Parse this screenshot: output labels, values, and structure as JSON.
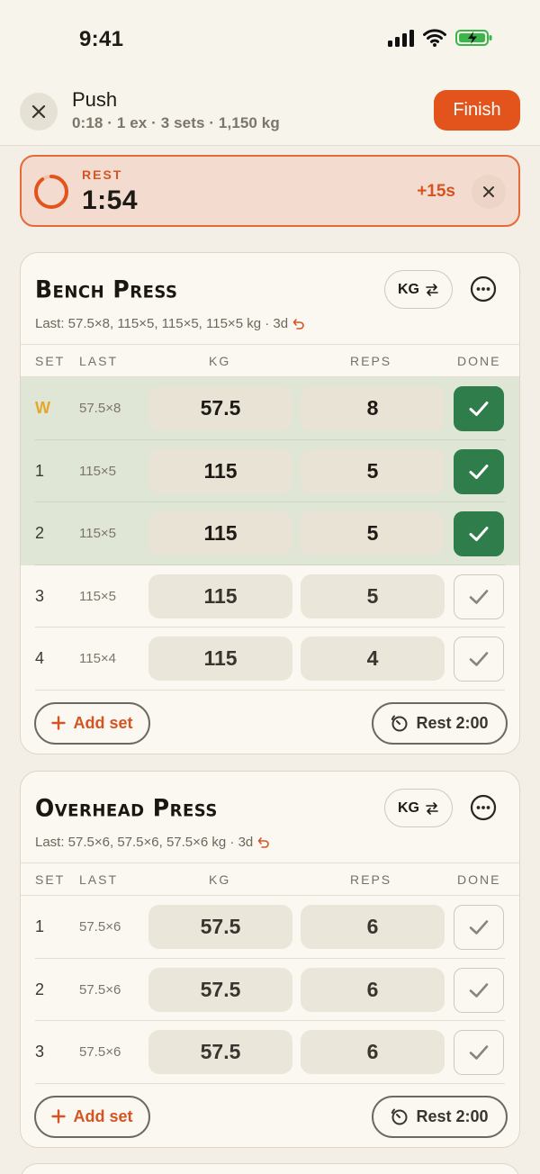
{
  "status": {
    "time": "9:41"
  },
  "header": {
    "title": "Push",
    "subtitle": "0:18 · 1 ex · 3 sets · 1,150 kg",
    "finish_label": "Finish"
  },
  "rest_banner": {
    "label": "REST",
    "time": "1:54",
    "add_label": "+15s",
    "progress": 0.9
  },
  "columns": {
    "set": "SET",
    "last": "LAST",
    "kg": "KG",
    "reps": "REPS",
    "done": "DONE"
  },
  "exercises": [
    {
      "name": "Bench Press",
      "unit_label": "KG",
      "last_summary": "Last: 57.5×8, 115×5, 115×5, 115×5 kg · 3d",
      "add_set_label": "Add set",
      "rest_label": "Rest 2:00",
      "sets": [
        {
          "set": "W",
          "last": "57.5×8",
          "kg": "57.5",
          "reps": "8",
          "done": true
        },
        {
          "set": "1",
          "last": "115×5",
          "kg": "115",
          "reps": "5",
          "done": true
        },
        {
          "set": "2",
          "last": "115×5",
          "kg": "115",
          "reps": "5",
          "done": true
        },
        {
          "set": "3",
          "last": "115×5",
          "kg": "115",
          "reps": "5",
          "done": false
        },
        {
          "set": "4",
          "last": "115×4",
          "kg": "115",
          "reps": "4",
          "done": false
        }
      ]
    },
    {
      "name": "Overhead Press",
      "unit_label": "KG",
      "last_summary": "Last: 57.5×6, 57.5×6, 57.5×6 kg · 3d",
      "add_set_label": "Add set",
      "rest_label": "Rest 2:00",
      "sets": [
        {
          "set": "1",
          "last": "57.5×6",
          "kg": "57.5",
          "reps": "6",
          "done": false
        },
        {
          "set": "2",
          "last": "57.5×6",
          "kg": "57.5",
          "reps": "6",
          "done": false
        },
        {
          "set": "3",
          "last": "57.5×6",
          "kg": "57.5",
          "reps": "6",
          "done": false
        }
      ]
    }
  ],
  "colors": {
    "accent": "#e2541c",
    "done_green": "#2f7d4a",
    "warmup": "#e6a62a"
  }
}
